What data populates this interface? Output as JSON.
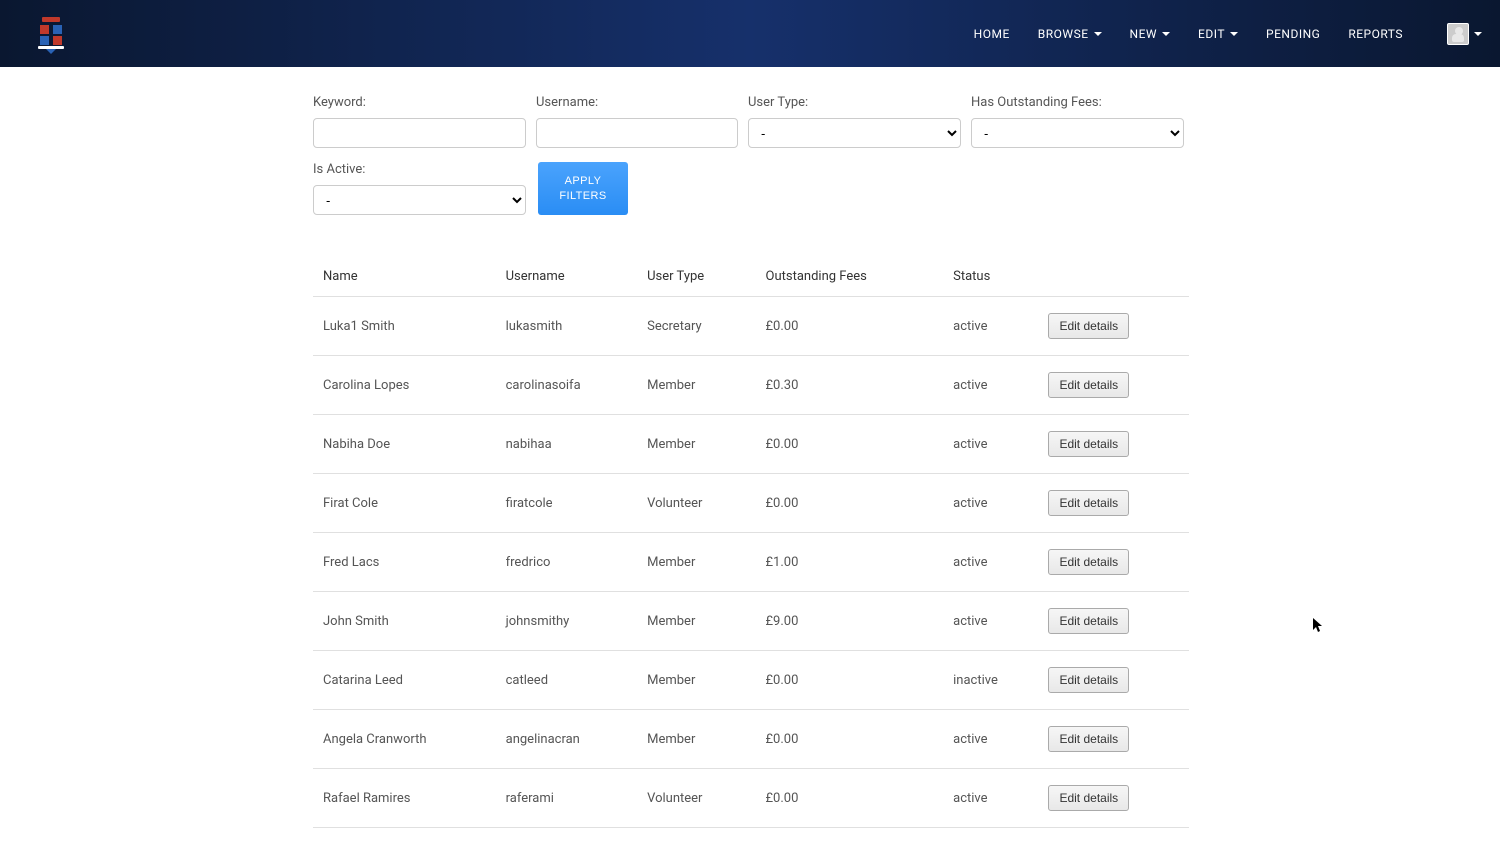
{
  "nav": {
    "items": [
      {
        "label": "HOME",
        "dropdown": false
      },
      {
        "label": "BROWSE",
        "dropdown": true
      },
      {
        "label": "NEW",
        "dropdown": true
      },
      {
        "label": "EDIT",
        "dropdown": true
      },
      {
        "label": "PENDING",
        "dropdown": false
      },
      {
        "label": "REPORTS",
        "dropdown": false
      }
    ]
  },
  "filters": {
    "keyword_label": "Keyword:",
    "keyword_value": "",
    "username_label": "Username:",
    "username_value": "",
    "usertype_label": "User Type:",
    "usertype_value": "-",
    "fees_label": "Has Outstanding Fees:",
    "fees_value": "-",
    "active_label": "Is Active:",
    "active_value": "-",
    "apply_label": "APPLY FILTERS"
  },
  "table": {
    "columns": {
      "name": "Name",
      "username": "Username",
      "usertype": "User Type",
      "fees": "Outstanding Fees",
      "status": "Status"
    },
    "edit_label": "Edit details",
    "rows": [
      {
        "name": "Luka1 Smith",
        "username": "lukasmith",
        "usertype": "Secretary",
        "fees": "£0.00",
        "status": "active"
      },
      {
        "name": "Carolina Lopes",
        "username": "carolinasoifa",
        "usertype": "Member",
        "fees": "£0.30",
        "status": "active"
      },
      {
        "name": "Nabiha Doe",
        "username": "nabihaa",
        "usertype": "Member",
        "fees": "£0.00",
        "status": "active"
      },
      {
        "name": "Firat Cole",
        "username": "firatcole",
        "usertype": "Volunteer",
        "fees": "£0.00",
        "status": "active"
      },
      {
        "name": "Fred Lacs",
        "username": "fredrico",
        "usertype": "Member",
        "fees": "£1.00",
        "status": "active"
      },
      {
        "name": "John Smith",
        "username": "johnsmithy",
        "usertype": "Member",
        "fees": "£9.00",
        "status": "active"
      },
      {
        "name": "Catarina Leed",
        "username": "catleed",
        "usertype": "Member",
        "fees": "£0.00",
        "status": "inactive"
      },
      {
        "name": "Angela Cranworth",
        "username": "angelinacran",
        "usertype": "Member",
        "fees": "£0.00",
        "status": "active"
      },
      {
        "name": "Rafael Ramires",
        "username": "raferami",
        "usertype": "Volunteer",
        "fees": "£0.00",
        "status": "active"
      }
    ]
  }
}
